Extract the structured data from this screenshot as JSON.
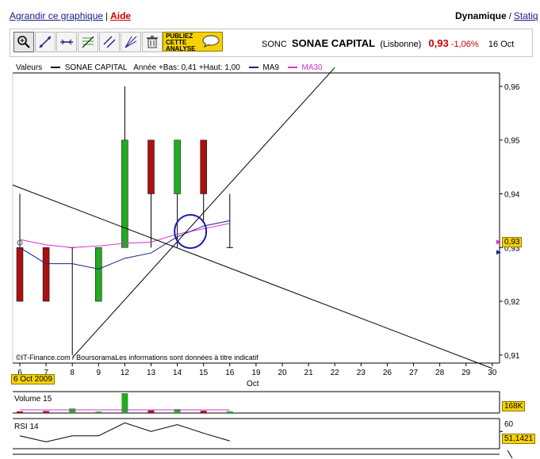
{
  "header": {
    "enlarge_link": "Agrandir ce graphique",
    "separator": "|",
    "help_link": "Aide",
    "mode_dynamic": "Dynamique",
    "mode_separator": "/",
    "mode_static": "Statiq"
  },
  "toolbar": {
    "tools": [
      "zoom-icon",
      "line-icon",
      "horizontal-line-icon",
      "fibonacci-icon",
      "channel-icon",
      "fan-icon",
      "trash-icon"
    ],
    "publish_line1": "PUBLIEZ",
    "publish_line2": "CETTE",
    "publish_line3": "ANALYSE"
  },
  "ticker": {
    "symbol": "SONC",
    "name": "SONAE CAPITAL",
    "exchange": "(Lisbonne)",
    "price": "0,93",
    "change": "-1,06%",
    "date": "16 Oct"
  },
  "legend": {
    "label": "Valeurs",
    "series_name": "SONAE CAPITAL",
    "series_info": "Année +Bas: 0,41 +Haut: 1,00",
    "ma9": "MA9",
    "ma30": "MA30"
  },
  "footer": {
    "credit": "IT-Finance.com / BoursoramaLes informations sont données à titre indicatif",
    "start_date": "6 Oct 2009",
    "month_label": "Oct"
  },
  "colors": {
    "up": "#22aa22",
    "down": "#aa1111",
    "ma9": "#1a237e",
    "ma30": "#d630d6",
    "accent": "#f7d200"
  },
  "chart_data": [
    {
      "type": "candlestick",
      "x_ticks": [
        "6",
        "7",
        "8",
        "9",
        "12",
        "13",
        "14",
        "15",
        "16",
        "19",
        "20",
        "21",
        "22",
        "23",
        "26",
        "27",
        "28",
        "29",
        "30"
      ],
      "y_ticks": [
        "0,96",
        "0,95",
        "0,94",
        "0,93",
        "0,92",
        "0,91"
      ],
      "ylim": [
        0.9085,
        0.9625
      ],
      "last_value_label": "0,93",
      "candles": [
        {
          "x": "6",
          "open": 0.93,
          "high": 0.94,
          "low": 0.92,
          "close": 0.92
        },
        {
          "x": "7",
          "open": 0.93,
          "high": 0.93,
          "low": 0.92,
          "close": 0.92
        },
        {
          "x": "8",
          "open": 0.93,
          "high": 0.93,
          "low": 0.91,
          "close": 0.93
        },
        {
          "x": "9",
          "open": 0.92,
          "high": 0.93,
          "low": 0.92,
          "close": 0.93
        },
        {
          "x": "12",
          "open": 0.93,
          "high": 0.96,
          "low": 0.93,
          "close": 0.95
        },
        {
          "x": "13",
          "open": 0.95,
          "high": 0.95,
          "low": 0.93,
          "close": 0.94
        },
        {
          "x": "14",
          "open": 0.94,
          "high": 0.95,
          "low": 0.93,
          "close": 0.95
        },
        {
          "x": "15",
          "open": 0.95,
          "high": 0.95,
          "low": 0.935,
          "close": 0.94
        },
        {
          "x": "16",
          "open": 0.93,
          "high": 0.94,
          "low": 0.93,
          "close": 0.93
        }
      ],
      "ma9": [
        0.93,
        0.927,
        0.927,
        0.926,
        0.928,
        0.929,
        0.932,
        0.934,
        0.935
      ],
      "ma30": [
        0.9315,
        0.9305,
        0.93,
        0.9303,
        0.9308,
        0.931,
        0.9325,
        0.9335,
        0.9345
      ],
      "trendlines": [
        {
          "from": [
            "5",
            0.943
          ],
          "to": [
            "30",
            0.9075
          ]
        },
        {
          "from": [
            "8",
            0.9095
          ],
          "to": [
            "22",
            0.9635
          ]
        }
      ],
      "circle": {
        "x": "14.5",
        "y": 0.933
      }
    },
    {
      "type": "bar",
      "title": "Volume 15",
      "categories": [
        "6",
        "7",
        "8",
        "9",
        "12",
        "13",
        "14",
        "15",
        "16"
      ],
      "values": [
        30,
        35,
        80,
        25,
        350,
        45,
        70,
        40,
        30
      ],
      "last_value_label": "168K"
    },
    {
      "type": "line",
      "title": "RSI 14",
      "categories": [
        "6",
        "7",
        "8",
        "9",
        "12",
        "13",
        "14",
        "15",
        "16"
      ],
      "values": [
        55,
        48,
        55,
        55,
        70,
        60,
        68,
        58,
        49
      ],
      "y_ticks": [
        "60"
      ],
      "last_value_label": "51,1421"
    }
  ]
}
